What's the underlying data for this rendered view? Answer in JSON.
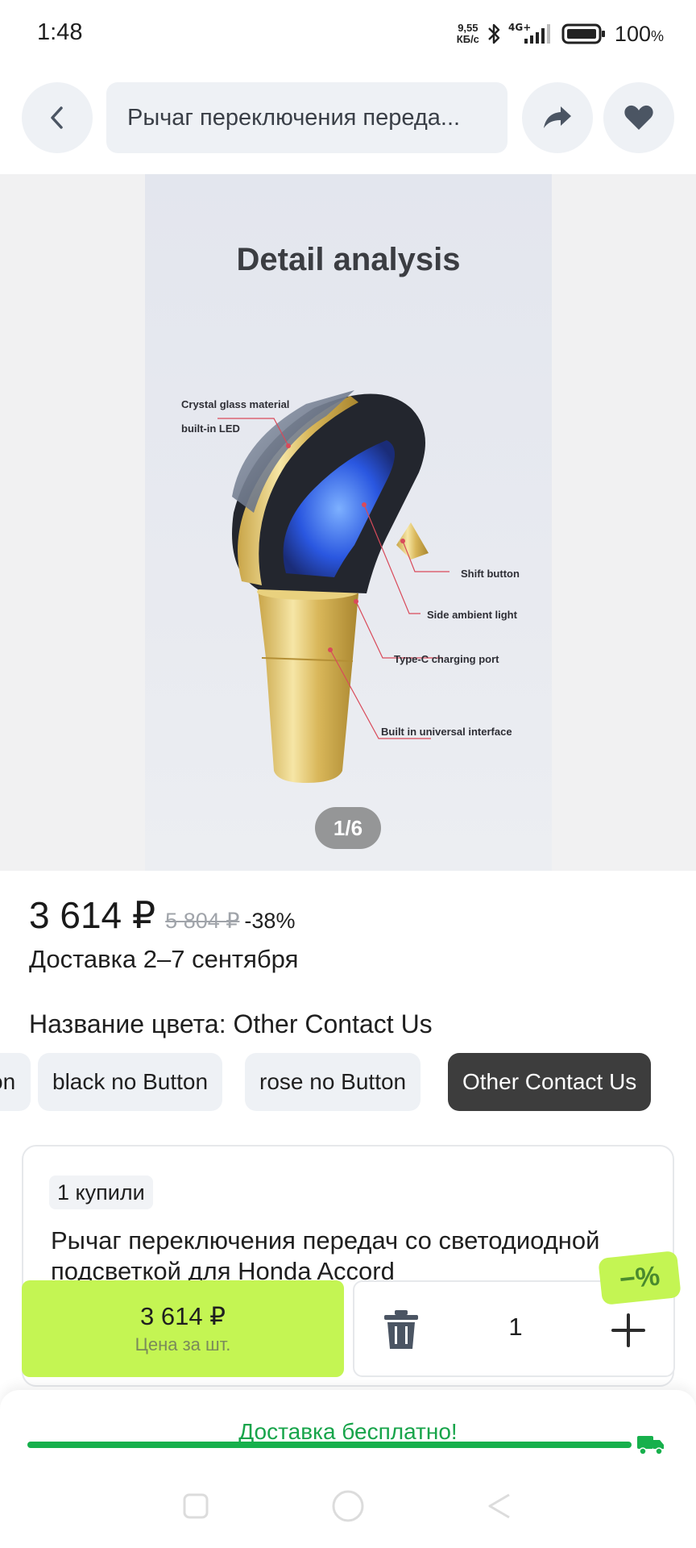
{
  "status_bar": {
    "time": "1:48",
    "net_speed_value": "9,55",
    "net_speed_unit": "КБ/с",
    "network": "4G+",
    "battery": "100",
    "battery_unit": "%"
  },
  "nav": {
    "search_text": "Рычаг переключения переда..."
  },
  "gallery": {
    "heading": "Detail analysis",
    "callouts": {
      "crystal_line1": "Crystal glass material",
      "crystal_line2": "built-in LED",
      "shift_button": "Shift button",
      "side_light": "Side ambient light",
      "type_c": "Type-C charging port",
      "interface": "Built in universal interface"
    },
    "page_indicator": "1/6"
  },
  "price": {
    "current": "3 614 ₽",
    "old": "5 804 ₽",
    "discount": "-38%"
  },
  "delivery_date": "Доставка 2–7 сентября",
  "color": {
    "label": "Название цвета: Other Contact Us",
    "options": [
      "on",
      "black no Button",
      "rose  no Button",
      "Other Contact Us"
    ],
    "selected_index": 3
  },
  "product_card": {
    "bought": "1 купили",
    "title": "Рычаг переключения передач со светодиодной подсветкой для Honda Accord"
  },
  "cart": {
    "price": "3 614 ₽",
    "price_caption": "Цена за шт.",
    "quantity": "1",
    "promo": "−%"
  },
  "delivery_sheet": {
    "free_delivery": "Доставка бесплатно!",
    "progress": 1.0
  },
  "colors": {
    "accent_green": "#c4f553",
    "delivery_green": "#17a44a"
  }
}
